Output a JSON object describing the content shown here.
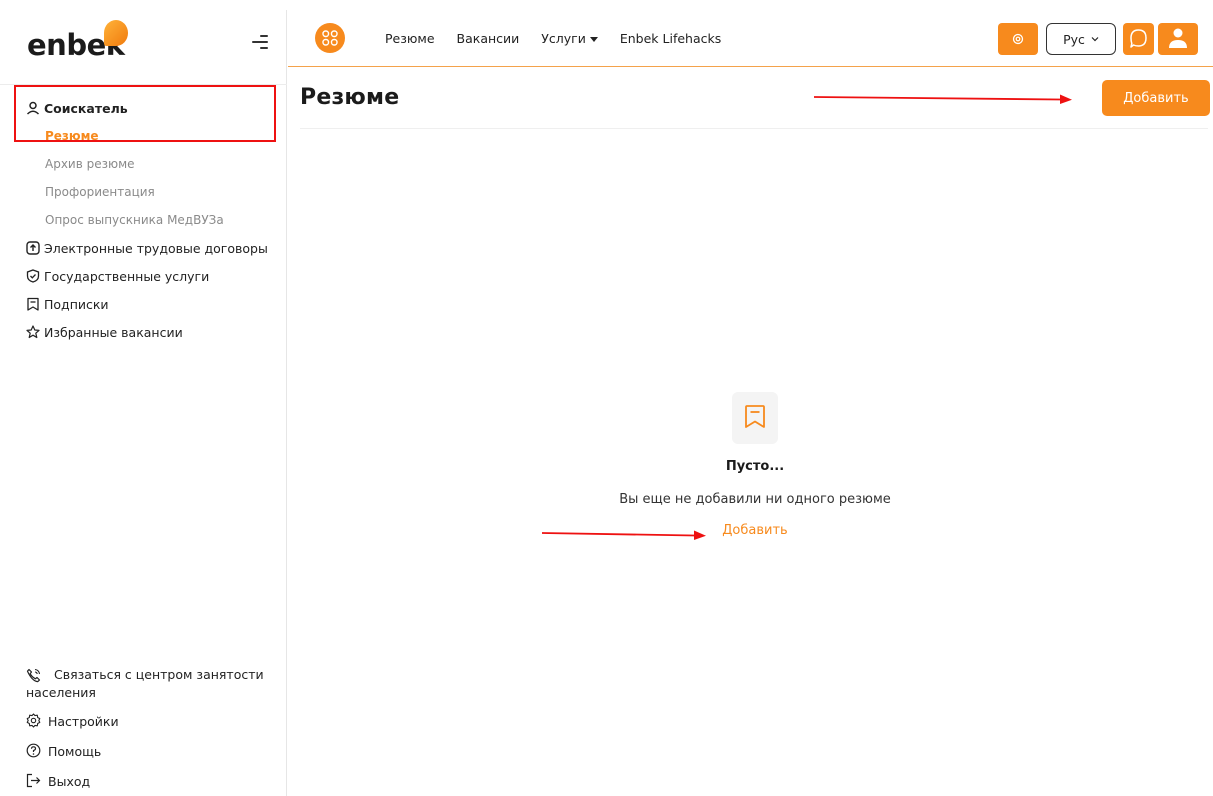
{
  "brand": {
    "logo_text": "enbek",
    "accent_color": "#f78a1d"
  },
  "sidebar": {
    "section_label": "Соискатель",
    "sub_items": [
      {
        "label": "Резюме",
        "active": true
      },
      {
        "label": "Архив резюме"
      },
      {
        "label": "Профориентация"
      },
      {
        "label": "Опрос выпускника МедВУЗа"
      }
    ],
    "items": [
      {
        "label": "Электронные трудовые договоры",
        "icon": "contract-icon"
      },
      {
        "label": "Государственные услуги",
        "icon": "shield-icon"
      },
      {
        "label": "Подписки",
        "icon": "bookmark-icon"
      },
      {
        "label": "Избранные вакансии",
        "icon": "star-icon"
      }
    ],
    "bottom": {
      "contact_line1": "Связаться с центром занятости",
      "contact_line2": "населения",
      "settings": "Настройки",
      "help": "Помощь",
      "logout": "Выход"
    }
  },
  "topbar": {
    "nav": [
      "Резюме",
      "Вакансии",
      "Услуги",
      "Enbek Lifehacks"
    ],
    "language": "Рус"
  },
  "main": {
    "title": "Резюме",
    "add_button": "Добавить",
    "empty_title": "Пусто...",
    "empty_description": "Вы еще не добавили ни одного резюме",
    "empty_add_link": "Добавить"
  }
}
